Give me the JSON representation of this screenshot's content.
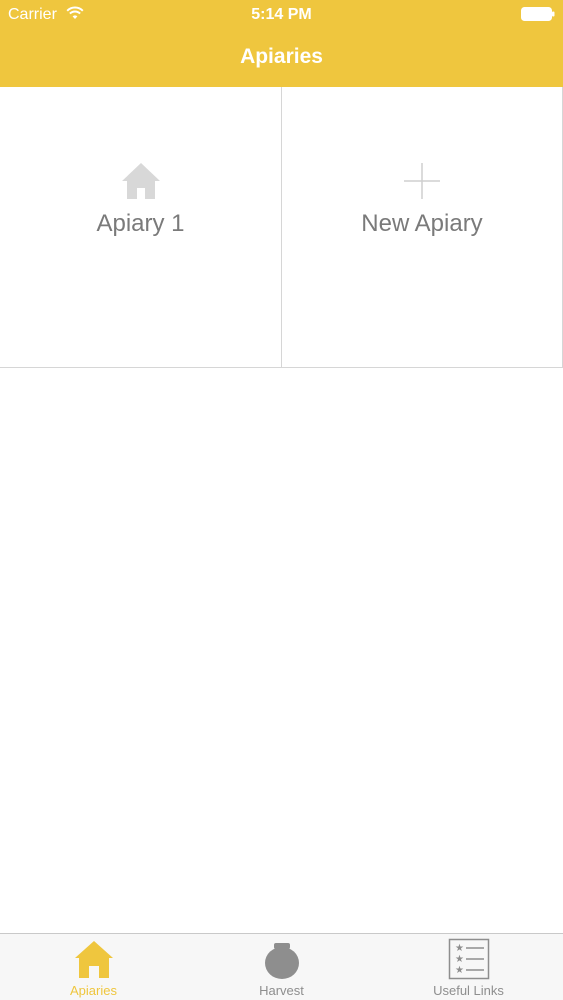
{
  "status_bar": {
    "carrier": "Carrier",
    "time": "5:14 PM",
    "wifi_icon": "wifi-icon",
    "battery_icon": "battery-icon"
  },
  "nav": {
    "title": "Apiaries"
  },
  "grid": {
    "items": [
      {
        "label": "Apiary 1",
        "icon": "house-icon"
      },
      {
        "label": "New Apiary",
        "icon": "plus-icon"
      }
    ]
  },
  "tab_bar": {
    "tabs": [
      {
        "label": "Apiaries",
        "icon": "house-icon",
        "selected": true
      },
      {
        "label": "Harvest",
        "icon": "honey-pot-icon",
        "selected": false
      },
      {
        "label": "Useful Links",
        "icon": "star-list-icon",
        "selected": false
      }
    ]
  },
  "colors": {
    "brand_yellow": "#efc63e",
    "tab_inactive": "#8e8e8e",
    "tile_text": "#7a7a7a",
    "divider": "#d6d6d6"
  }
}
